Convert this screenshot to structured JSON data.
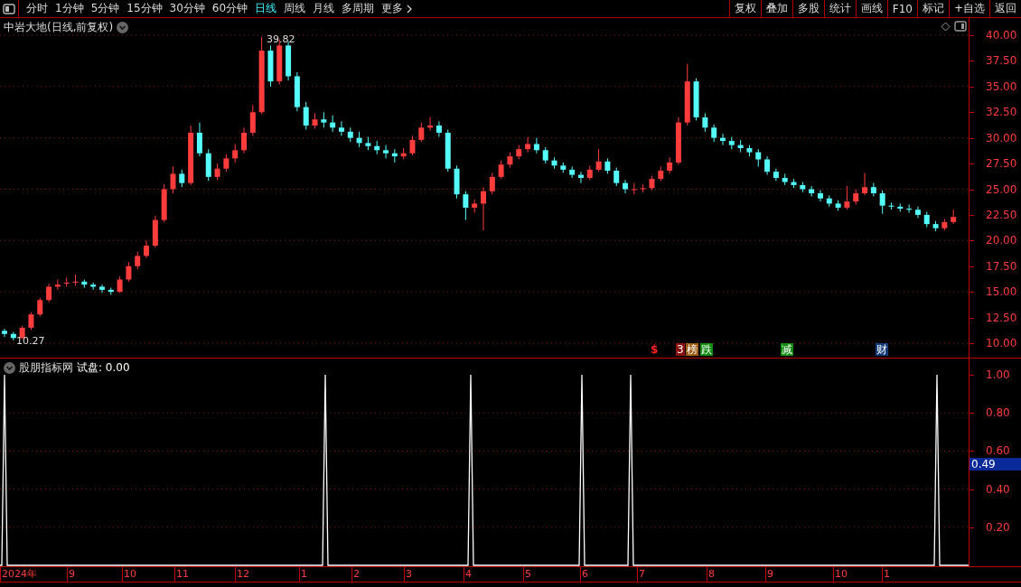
{
  "toolbar": {
    "periods": [
      {
        "label": "分时",
        "selected": false
      },
      {
        "label": "1分钟",
        "selected": false
      },
      {
        "label": "5分钟",
        "selected": false
      },
      {
        "label": "15分钟",
        "selected": false
      },
      {
        "label": "30分钟",
        "selected": false
      },
      {
        "label": "60分钟",
        "selected": false
      },
      {
        "label": "日线",
        "selected": true
      },
      {
        "label": "周线",
        "selected": false
      },
      {
        "label": "月线",
        "selected": false
      },
      {
        "label": "多周期",
        "selected": false
      }
    ],
    "more": "更多",
    "actions": [
      "复权",
      "叠加",
      "多股",
      "统计",
      "画线",
      "F10",
      "标记",
      "+自选",
      "返回"
    ]
  },
  "price_pane": {
    "title": "中岩大地(日线,前复权)",
    "high_label": "39.82",
    "low_label": "10.27",
    "chart_data": {
      "type": "candlestick",
      "ylim": [
        10,
        40
      ],
      "grid": true,
      "yticks": [
        {
          "value": 40,
          "label": "40.00"
        },
        {
          "value": 37.5,
          "label": "37.50"
        },
        {
          "value": 35,
          "label": "35.00"
        },
        {
          "value": 32.5,
          "label": "32.50"
        },
        {
          "value": 30,
          "label": "30.00"
        },
        {
          "value": 27.5,
          "label": "27.50"
        },
        {
          "value": 25,
          "label": "25.00"
        },
        {
          "value": 22.5,
          "label": "22.50"
        },
        {
          "value": 20,
          "label": "20.00"
        },
        {
          "value": 17.5,
          "label": "17.50"
        },
        {
          "value": 15,
          "label": "15.00"
        },
        {
          "value": 12.5,
          "label": "12.50"
        },
        {
          "value": 10,
          "label": "10.00"
        }
      ],
      "ohlc": [
        [
          11.2,
          11.4,
          10.6,
          10.9
        ],
        [
          10.9,
          11.1,
          10.27,
          10.5
        ],
        [
          10.5,
          11.7,
          10.4,
          11.5
        ],
        [
          11.5,
          13.0,
          11.3,
          12.8
        ],
        [
          12.8,
          14.4,
          12.6,
          14.2
        ],
        [
          14.2,
          15.8,
          14.0,
          15.5
        ],
        [
          15.5,
          16.2,
          15.2,
          15.7
        ],
        [
          15.8,
          16.4,
          15.5,
          15.9
        ],
        [
          15.9,
          16.7,
          15.6,
          16.0
        ],
        [
          16.0,
          16.2,
          15.4,
          15.7
        ],
        [
          15.7,
          15.9,
          15.2,
          15.5
        ],
        [
          15.5,
          15.7,
          14.9,
          15.2
        ],
        [
          15.2,
          15.4,
          14.7,
          15.0
        ],
        [
          15.0,
          16.5,
          14.9,
          16.2
        ],
        [
          16.2,
          17.9,
          16.0,
          17.5
        ],
        [
          17.5,
          18.9,
          17.2,
          18.5
        ],
        [
          18.5,
          20.0,
          18.3,
          19.5
        ],
        [
          19.5,
          22.4,
          19.3,
          22.0
        ],
        [
          22.0,
          25.5,
          21.8,
          25.0
        ],
        [
          25.0,
          27.2,
          24.6,
          26.5
        ],
        [
          26.5,
          26.9,
          25.2,
          25.6
        ],
        [
          25.6,
          31.2,
          25.4,
          30.5
        ],
        [
          30.5,
          31.5,
          28.2,
          28.5
        ],
        [
          28.5,
          28.9,
          25.8,
          26.2
        ],
        [
          26.2,
          27.5,
          25.9,
          27.0
        ],
        [
          27.0,
          28.4,
          26.7,
          28.0
        ],
        [
          28.0,
          29.4,
          27.6,
          28.8
        ],
        [
          28.8,
          31.0,
          28.5,
          30.5
        ],
        [
          30.5,
          33.2,
          30.2,
          32.5
        ],
        [
          32.5,
          39.82,
          32.3,
          38.5
        ],
        [
          38.5,
          39.0,
          35.0,
          35.5
        ],
        [
          35.5,
          39.6,
          35.2,
          39.0
        ],
        [
          39.0,
          39.4,
          35.6,
          36.0
        ],
        [
          36.0,
          36.4,
          32.6,
          33.0
        ],
        [
          33.0,
          33.5,
          30.8,
          31.2
        ],
        [
          31.2,
          32.4,
          30.9,
          31.8
        ],
        [
          31.8,
          32.5,
          31.0,
          31.5
        ],
        [
          31.5,
          32.2,
          30.6,
          31.0
        ],
        [
          31.0,
          31.6,
          30.2,
          30.6
        ],
        [
          30.6,
          31.0,
          29.6,
          30.0
        ],
        [
          30.0,
          30.6,
          29.1,
          29.5
        ],
        [
          29.5,
          30.1,
          28.8,
          29.2
        ],
        [
          29.2,
          29.7,
          28.4,
          28.8
        ],
        [
          28.8,
          29.3,
          28.0,
          28.5
        ],
        [
          28.5,
          28.9,
          27.6,
          28.2
        ],
        [
          28.2,
          29.0,
          27.9,
          28.5
        ],
        [
          28.5,
          30.2,
          28.3,
          29.8
        ],
        [
          29.8,
          31.5,
          29.6,
          31.0
        ],
        [
          31.0,
          32.0,
          30.7,
          31.2
        ],
        [
          31.2,
          31.6,
          30.1,
          30.5
        ],
        [
          30.5,
          30.8,
          26.7,
          27.0
        ],
        [
          27.0,
          27.3,
          24.1,
          24.5
        ],
        [
          24.5,
          24.8,
          22.0,
          23.2
        ],
        [
          23.2,
          24.0,
          22.7,
          23.6
        ],
        [
          23.6,
          25.2,
          21.0,
          24.8
        ],
        [
          24.8,
          26.6,
          24.5,
          26.2
        ],
        [
          26.2,
          27.8,
          26.0,
          27.4
        ],
        [
          27.4,
          28.6,
          27.1,
          28.2
        ],
        [
          28.2,
          29.3,
          27.9,
          28.9
        ],
        [
          28.9,
          30.1,
          28.6,
          29.4
        ],
        [
          29.4,
          30.0,
          28.5,
          28.8
        ],
        [
          28.8,
          29.1,
          27.5,
          27.8
        ],
        [
          27.8,
          28.1,
          27.0,
          27.3
        ],
        [
          27.3,
          27.6,
          26.6,
          26.9
        ],
        [
          26.9,
          27.2,
          26.1,
          26.4
        ],
        [
          26.4,
          26.7,
          25.6,
          26.1
        ],
        [
          26.1,
          27.3,
          25.9,
          26.9
        ],
        [
          26.9,
          28.9,
          26.7,
          27.7
        ],
        [
          27.7,
          28.0,
          26.5,
          26.8
        ],
        [
          26.8,
          27.1,
          25.3,
          25.6
        ],
        [
          25.6,
          25.9,
          24.6,
          25.0
        ],
        [
          25.0,
          25.6,
          24.5,
          25.0
        ],
        [
          25.0,
          25.5,
          24.7,
          25.1
        ],
        [
          25.1,
          26.3,
          24.9,
          26.0
        ],
        [
          26.0,
          27.2,
          25.8,
          26.8
        ],
        [
          26.8,
          28.1,
          26.5,
          27.6
        ],
        [
          27.6,
          32.0,
          27.4,
          31.5
        ],
        [
          31.5,
          37.2,
          31.2,
          35.5
        ],
        [
          35.5,
          35.8,
          31.7,
          32.0
        ],
        [
          32.0,
          32.4,
          30.6,
          31.0
        ],
        [
          31.0,
          31.3,
          29.6,
          30.0
        ],
        [
          30.0,
          30.4,
          29.3,
          29.7
        ],
        [
          29.7,
          30.1,
          28.9,
          29.3
        ],
        [
          29.3,
          29.8,
          28.6,
          29.0
        ],
        [
          29.0,
          29.3,
          28.2,
          28.6
        ],
        [
          28.6,
          28.9,
          27.2,
          27.9
        ],
        [
          27.9,
          28.2,
          26.4,
          26.7
        ],
        [
          26.7,
          27.0,
          25.8,
          26.1
        ],
        [
          26.1,
          26.5,
          25.4,
          25.7
        ],
        [
          25.7,
          26.0,
          25.1,
          25.4
        ],
        [
          25.4,
          25.7,
          24.7,
          25.0
        ],
        [
          25.0,
          25.3,
          24.3,
          24.6
        ],
        [
          24.6,
          24.9,
          23.8,
          24.1
        ],
        [
          24.1,
          24.4,
          23.3,
          23.6
        ],
        [
          23.6,
          23.9,
          22.9,
          23.2
        ],
        [
          23.2,
          25.3,
          23.0,
          23.8
        ],
        [
          23.8,
          25.0,
          23.5,
          24.6
        ],
        [
          24.6,
          26.6,
          24.4,
          25.2
        ],
        [
          25.2,
          25.6,
          24.3,
          24.6
        ],
        [
          24.6,
          24.9,
          22.6,
          23.4
        ],
        [
          23.4,
          23.7,
          23.0,
          23.3
        ],
        [
          23.3,
          23.6,
          22.8,
          23.1
        ],
        [
          23.1,
          23.5,
          22.7,
          23.0
        ],
        [
          23.0,
          23.3,
          22.2,
          22.5
        ],
        [
          22.5,
          22.8,
          21.3,
          21.6
        ],
        [
          21.6,
          21.9,
          20.9,
          21.2
        ],
        [
          21.2,
          22.1,
          21.0,
          21.8
        ],
        [
          21.8,
          23.0,
          21.6,
          22.3
        ]
      ]
    },
    "events": [
      {
        "kind": "symbol",
        "text": "$",
        "color": "#ff2020"
      },
      {
        "kind": "tag",
        "text": "3",
        "color": "#8b1010"
      },
      {
        "kind": "tag",
        "text": "榜",
        "color": "#9a5a10"
      },
      {
        "kind": "tag",
        "text": "跌",
        "color": "#108a10"
      },
      {
        "kind": "tag",
        "text": "减",
        "color": "#108a10"
      },
      {
        "kind": "tag",
        "text": "财",
        "color": "#103a78"
      }
    ]
  },
  "indicator_pane": {
    "name": "股朋指标网",
    "reading": "试盘: 0.00",
    "yticks": [
      "1.00",
      "0.80",
      "0.60",
      "0.40",
      "0.20"
    ],
    "current_value": "0.49"
  },
  "date_axis": [
    "2024年",
    "9",
    "10",
    "11",
    "12",
    "1",
    "2",
    "3",
    "4",
    "5",
    "6",
    "7",
    "8",
    "9",
    "10",
    "1"
  ]
}
